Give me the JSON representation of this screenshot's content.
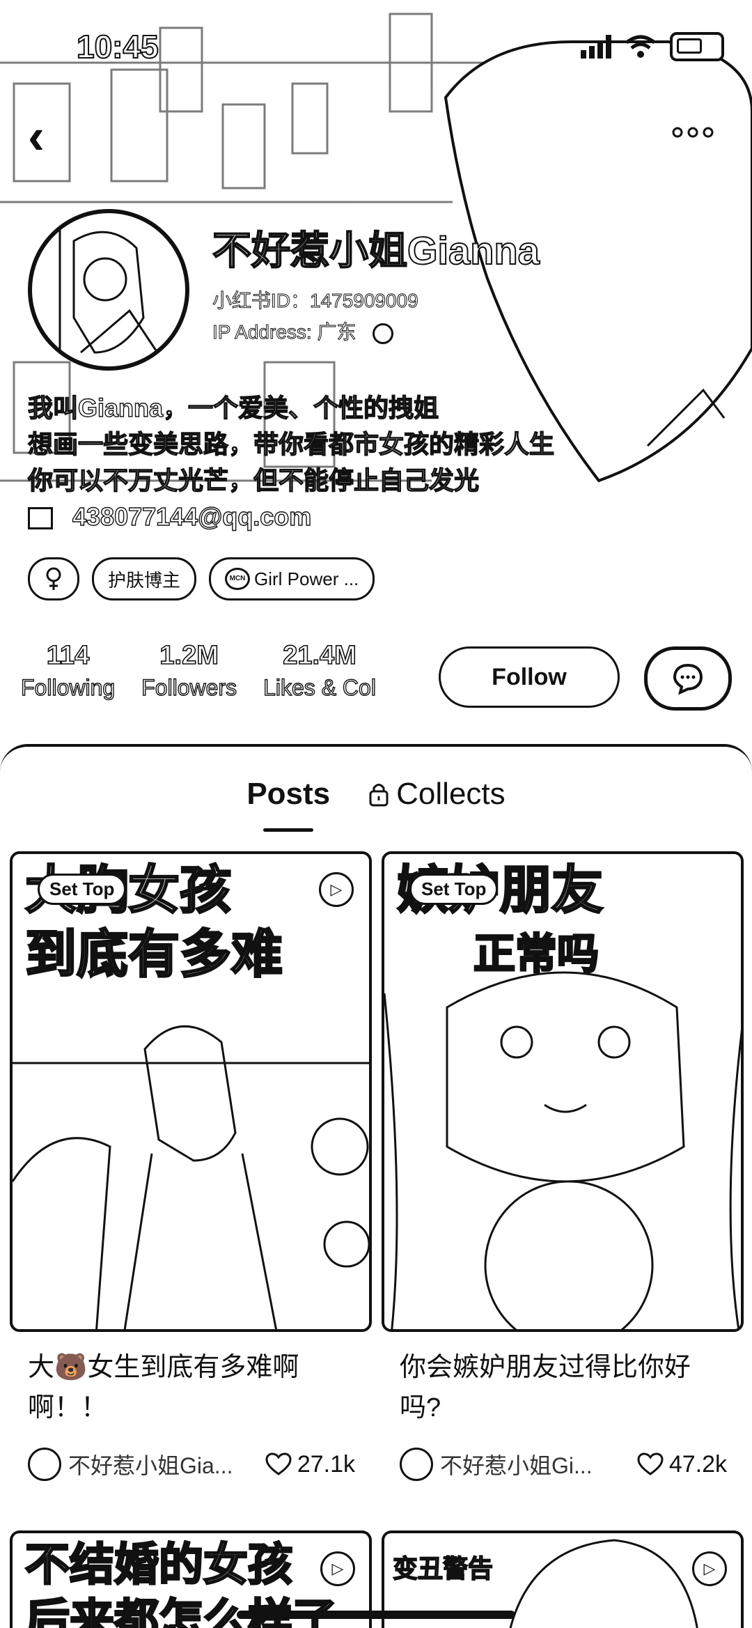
{
  "status": {
    "time": "10:45"
  },
  "profile": {
    "nickname": "不好惹小姐Gianna",
    "id_line": "小红书ID：1475909009",
    "ip_line": "IP Address: 广东",
    "bio": [
      "我叫Gianna，一个爱美、个性的拽姐",
      "想画一些变美思路，带你看都市女孩的精彩人生",
      "你可以不万丈光芒，但不能停止自己发光"
    ],
    "email": "438077144@qq.com",
    "tags": [
      "护肤博主",
      "Girl Power ..."
    ]
  },
  "stats": [
    {
      "num": "114",
      "label": "Following"
    },
    {
      "num": "1.2M",
      "label": "Followers"
    },
    {
      "num": "21.4M",
      "label": "Likes & Col"
    }
  ],
  "actions": {
    "follow": "Follow"
  },
  "tabs": {
    "posts": "Posts",
    "collects": "Collects"
  },
  "posts": [
    {
      "badge": "Set Top",
      "cover": [
        "大胸女孩",
        "到底有多难"
      ],
      "title": "大🐻女生到底有多难啊啊！！",
      "author": "不好惹小姐Gia...",
      "likes": "27.1k"
    },
    {
      "badge": "Set Top",
      "cover": [
        "嫉妒朋友",
        "正常吗"
      ],
      "title": "你会嫉妒朋友过得比你好吗?",
      "author": "不好惹小姐Gi...",
      "likes": "47.2k"
    },
    {
      "cover": [
        "不结婚的女孩",
        "后来都怎么样了"
      ]
    },
    {
      "cover": [
        "变丑警告"
      ]
    }
  ]
}
